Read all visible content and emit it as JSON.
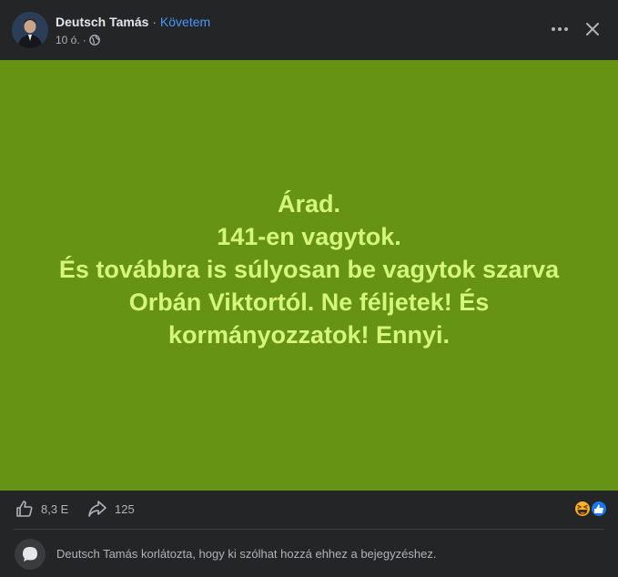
{
  "header": {
    "author_name": "Deutsch Tamás",
    "separator": "·",
    "follow_label": "Követem",
    "time": "10 ó.",
    "time_separator": "·",
    "privacy_icon": "globe-icon",
    "more_icon": "more-horizontal-icon",
    "close_icon": "close-icon"
  },
  "post": {
    "background_color": "#679315",
    "text_color": "#d4f77b",
    "lines": [
      "Árad.",
      "141-en vagytok.",
      "És továbbra is súlyosan be vagytok szarva",
      "Orbán Viktortól. Ne féljetek! És",
      "kormányozzatok! Ennyi."
    ]
  },
  "stats": {
    "likes_icon": "like-icon",
    "likes_count": "8,3 E",
    "shares_icon": "share-icon",
    "shares_count": "125",
    "reaction_icons": [
      "haha-reaction-icon",
      "like-reaction-icon"
    ]
  },
  "comments": {
    "restriction_note": "Deutsch Tamás korlátozta, hogy ki szólhat hozzá ehhez a bejegyzéshez."
  }
}
